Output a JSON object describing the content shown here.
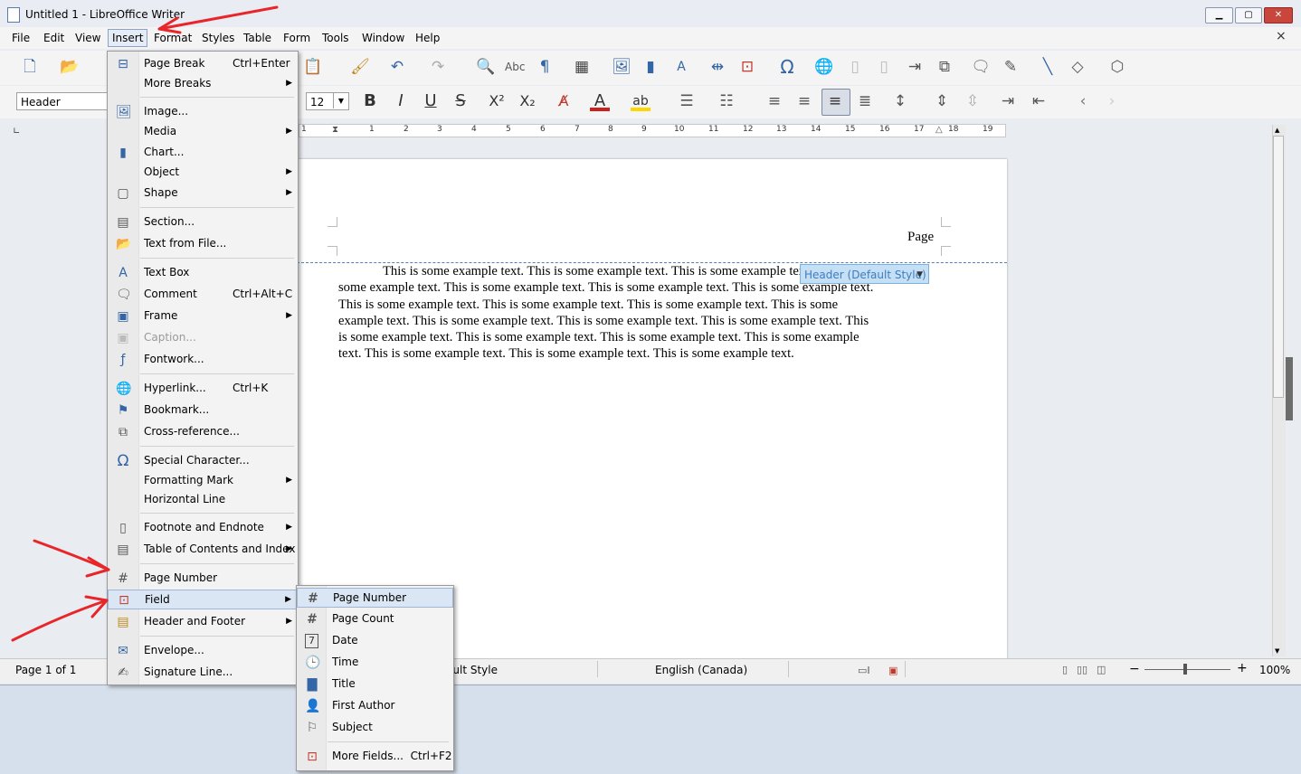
{
  "window": {
    "title": "Untitled 1 - LibreOffice Writer",
    "close_doc_glyph": "×"
  },
  "menubar": [
    "File",
    "Edit",
    "View",
    "Insert",
    "Format",
    "Styles",
    "Table",
    "Form",
    "Tools",
    "Window",
    "Help"
  ],
  "toolbar": {
    "paragraph_style": "Header",
    "font_size": "12"
  },
  "ruler": {
    "numbers": [
      "1",
      "1",
      "2",
      "3",
      "4",
      "5",
      "6",
      "7",
      "8",
      "9",
      "10",
      "11",
      "12",
      "13",
      "14",
      "15",
      "16",
      "17",
      "18",
      "19"
    ]
  },
  "document": {
    "header_text": "Page",
    "header_tag": "Header (Default Style)",
    "body_lines": [
      "This is some example text.  This is some example text.  This is some example text.  This is",
      "some example text.  This is some example text.  This is some example text.  This is some example text.",
      "This is some example text.  This is some example text.  This is some example text.  This is some",
      "example text.  This is some example text.  This is some example text.  This is some example text.  This",
      "is some example text.  This is some example text.  This is some example text.  This is some example",
      "text.  This is some example text.  This is some example text.  This is some example text."
    ]
  },
  "statusbar": {
    "page": "Page 1 of 1",
    "page_style": "Default Style",
    "language": "English (Canada)",
    "zoom": "100%"
  },
  "insert_menu": [
    {
      "label": "Page Break",
      "accel": "Ctrl+Enter",
      "icon": "page-break-icon"
    },
    {
      "label": "More Breaks",
      "submenu": true
    },
    {
      "label": "Image...",
      "icon": "image-icon"
    },
    {
      "label": "Media",
      "submenu": true
    },
    {
      "label": "Chart...",
      "icon": "chart-icon"
    },
    {
      "label": "Object",
      "submenu": true
    },
    {
      "label": "Shape",
      "submenu": true,
      "icon": "shape-icon"
    },
    {
      "label": "Section...",
      "icon": "section-icon"
    },
    {
      "label": "Text from File...",
      "icon": "folder-icon"
    },
    {
      "label": "Text Box",
      "icon": "textbox-icon"
    },
    {
      "label": "Comment",
      "accel": "Ctrl+Alt+C",
      "icon": "comment-icon"
    },
    {
      "label": "Frame",
      "submenu": true,
      "icon": "frame-icon"
    },
    {
      "label": "Caption...",
      "disabled": true,
      "icon": "caption-icon"
    },
    {
      "label": "Fontwork...",
      "icon": "fontwork-icon"
    },
    {
      "label": "Hyperlink...",
      "accel": "Ctrl+K",
      "icon": "hyperlink-icon"
    },
    {
      "label": "Bookmark...",
      "icon": "bookmark-icon"
    },
    {
      "label": "Cross-reference...",
      "icon": "crossref-icon"
    },
    {
      "label": "Special Character...",
      "icon": "omega-icon"
    },
    {
      "label": "Formatting Mark",
      "submenu": true
    },
    {
      "label": "Horizontal Line"
    },
    {
      "label": "Footnote and Endnote",
      "submenu": true,
      "icon": "footnote-icon"
    },
    {
      "label": "Table of Contents and Index",
      "submenu": true,
      "icon": "toc-icon"
    },
    {
      "label": "Page Number",
      "icon": "page-number-icon"
    },
    {
      "label": "Field",
      "submenu": true,
      "highlighted": true,
      "icon": "field-icon"
    },
    {
      "label": "Header and Footer",
      "submenu": true,
      "icon": "header-footer-icon"
    },
    {
      "label": "Envelope...",
      "icon": "envelope-icon"
    },
    {
      "label": "Signature Line...",
      "icon": "signature-icon"
    }
  ],
  "field_menu": [
    {
      "label": "Page Number",
      "icon": "page-number-icon",
      "highlighted": true
    },
    {
      "label": "Page Count",
      "icon": "page-count-icon"
    },
    {
      "label": "Date",
      "icon": "calendar-icon",
      "glyph": "7"
    },
    {
      "label": "Time",
      "icon": "clock-icon"
    },
    {
      "label": "Title",
      "icon": "document-icon"
    },
    {
      "label": "First Author",
      "icon": "person-icon"
    },
    {
      "label": "Subject",
      "icon": "subject-icon"
    },
    {
      "label": "More Fields...",
      "accel": "Ctrl+F2",
      "icon": "more-fields-icon"
    }
  ]
}
